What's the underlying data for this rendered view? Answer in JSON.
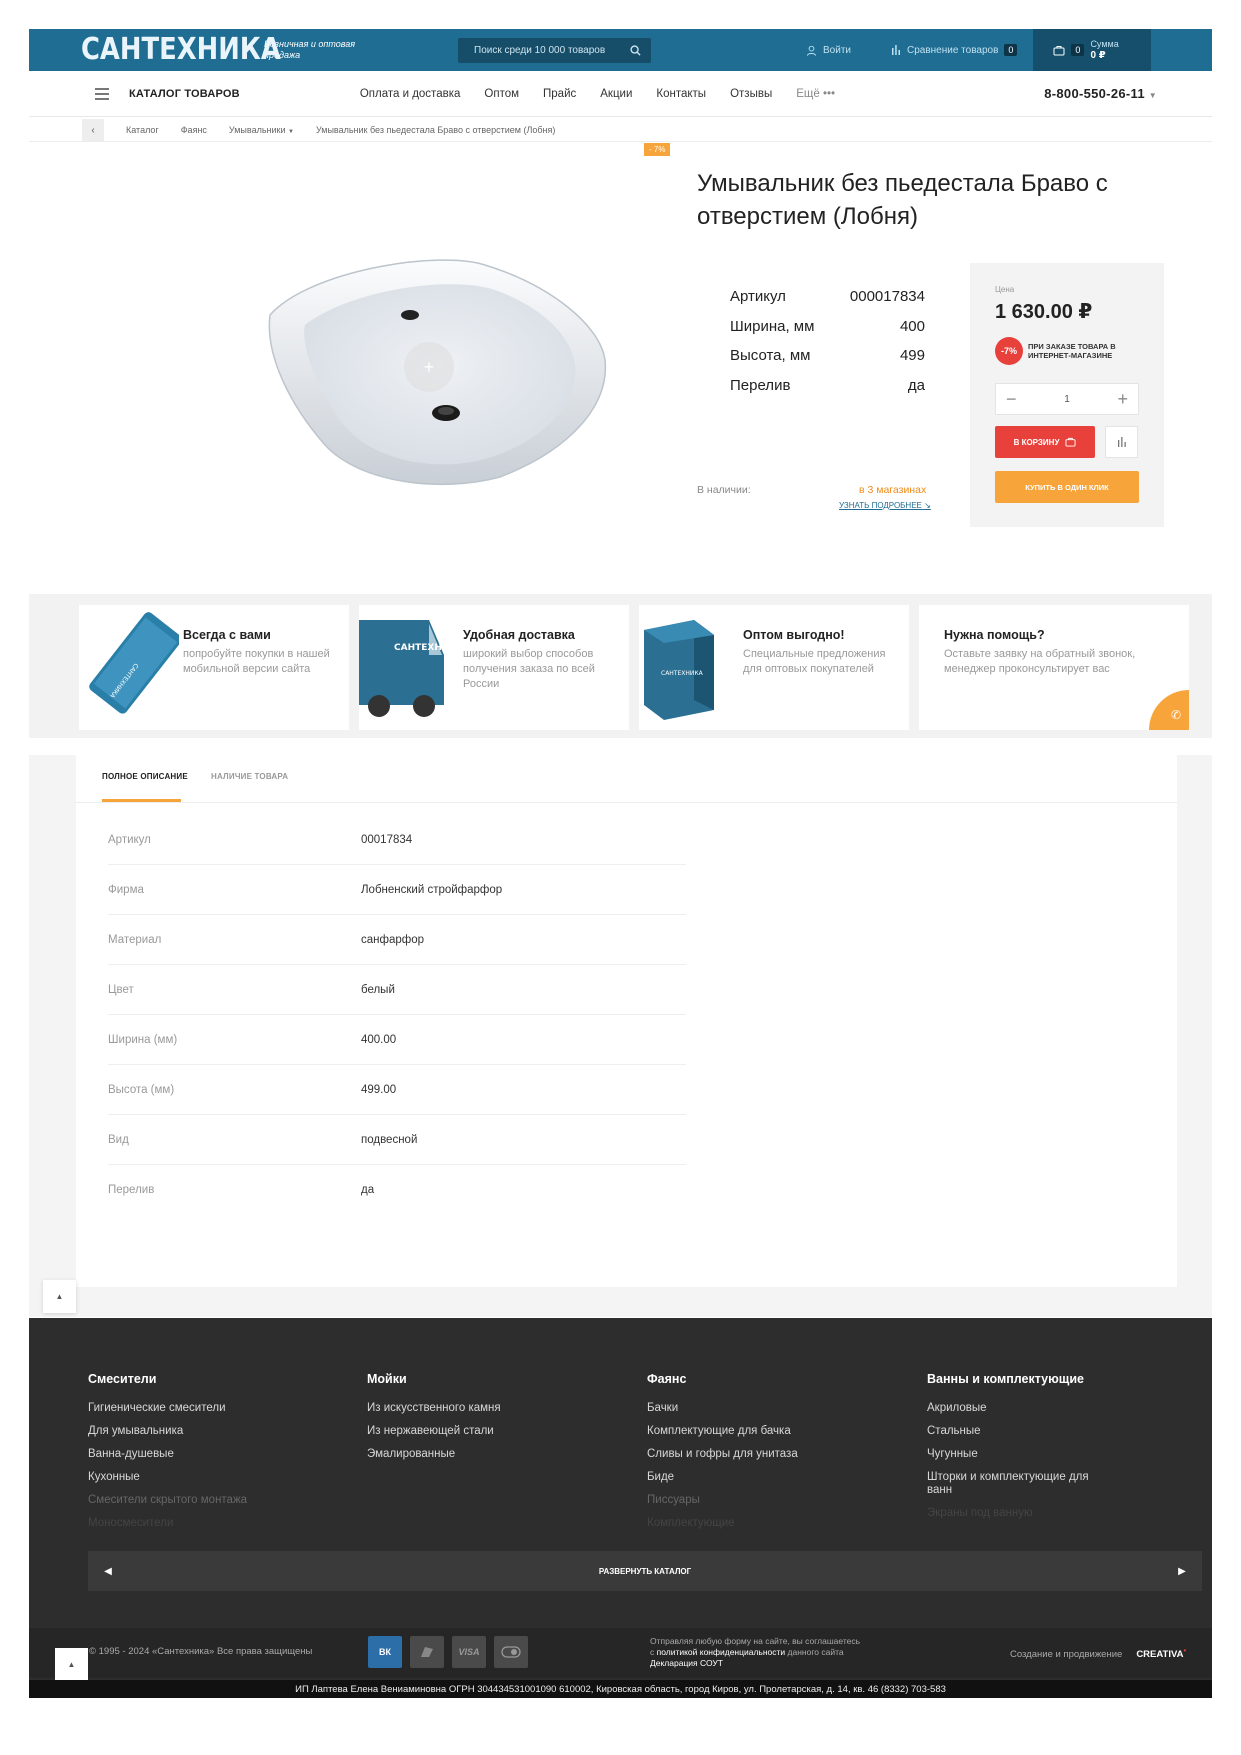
{
  "header": {
    "logo": "САНТЕХНИКА",
    "tagline": "Розничная и оптовая продажа",
    "search_placeholder": "Поиск среди 10 000 товаров",
    "login": "Войти",
    "compare": "Сравнение товаров",
    "compare_count": "0",
    "cart_count": "0",
    "sum_label": "Сумма",
    "sum_value": "0 ₽"
  },
  "nav": {
    "catalog": "КАТАЛОГ ТОВАРОВ",
    "items": [
      "Оплата и доставка",
      "Оптом",
      "Прайс",
      "Акции",
      "Контакты",
      "Отзывы"
    ],
    "more": "Ещё",
    "phone": "8-800-550-26-11"
  },
  "breadcrumb": [
    "Каталог",
    "Фаянс",
    "Умывальники",
    "Умывальник без пьедестала Браво с отверстием (Лобня)"
  ],
  "product": {
    "discount_tag": "- 7%",
    "title": "Умывальник без пьедестала Браво с отверстием (Лобня)",
    "props": [
      {
        "k": "Артикул",
        "v": "000017834"
      },
      {
        "k": "Ширина, мм",
        "v": "400"
      },
      {
        "k": "Высота, мм",
        "v": "499"
      },
      {
        "k": "Перелив",
        "v": "да"
      }
    ],
    "instock_label": "В наличии:",
    "instock_value": "в 3 магазинах",
    "more_link": "УЗНАТЬ ПОДРОБНЕЕ",
    "price_label": "Цена",
    "price": "1 630.00 ₽",
    "badge": "-7%",
    "badge_note": "ПРИ ЗАКАЗЕ ТОВАРА В ИНТЕРНЕТ-МАГАЗИНЕ",
    "qty": "1",
    "cart_btn": "В КОРЗИНУ",
    "one_click": "КУПИТЬ В ОДИН КЛИК"
  },
  "features": [
    {
      "title": "Всегда с вами",
      "text": "попробуйте покупки в нашей мобильной версии сайта"
    },
    {
      "title": "Удобная доставка",
      "text": "широкий выбор способов получения заказа по всей России"
    },
    {
      "title": "Оптом выгодно!",
      "text": "Специальные предложения для оптовых покупателей"
    },
    {
      "title": "Нужна помощь?",
      "text": "Оставьте заявку на обратный звонок, менеджер проконсультирует вас"
    }
  ],
  "tabs": [
    "ПОЛНОЕ ОПИСАНИЕ",
    "НАЛИЧИЕ ТОВАРА"
  ],
  "specs": [
    {
      "k": "Артикул",
      "v": "00017834"
    },
    {
      "k": "Фирма",
      "v": "Лобненский стройфарфор"
    },
    {
      "k": "Материал",
      "v": "санфарфор"
    },
    {
      "k": "Цвет",
      "v": "белый"
    },
    {
      "k": "Ширина (мм)",
      "v": "400.00"
    },
    {
      "k": "Высота (мм)",
      "v": "499.00"
    },
    {
      "k": "Вид",
      "v": "подвесной"
    },
    {
      "k": "Перелив",
      "v": "да"
    }
  ],
  "footer": {
    "cols": [
      {
        "h": "Смесители",
        "items": [
          "Гигиенические смесители",
          "Для умывальника",
          "Ванна-душевые",
          "Кухонные",
          "Смесители скрытого монтажа",
          "Моносмесители"
        ]
      },
      {
        "h": "Мойки",
        "items": [
          "Из искусственного камня",
          "Из нержавеющей стали",
          "Эмалированные"
        ]
      },
      {
        "h": "Фаянс",
        "items": [
          "Бачки",
          "Комплектующие для бачка",
          "Сливы и гофры для унитаза",
          "Биде",
          "Писсуары",
          "Комплектующие"
        ]
      },
      {
        "h": "Ванны и комплектующие",
        "items": [
          "Акриловые",
          "Стальные",
          "Чугунные",
          "Шторки и комплектующие для ванн",
          "Экраны под ванную"
        ]
      }
    ],
    "expand": "РАЗВЕРНУТЬ КАТАЛОГ",
    "copyright": "© 1995 - 2024 «Сантехника» Все права защищены",
    "pay": [
      "ВК",
      "",
      "VISA",
      ""
    ],
    "legal_1": "Отправляя любую форму на сайте, вы соглашаетесь",
    "legal_2a": "с ",
    "legal_2b": "политикой конфиденциальности",
    "legal_2c": " данного сайта",
    "legal_3": "Декларация СОУТ",
    "made": "Создание и продвижение",
    "studio": "CREATIVA",
    "address": "ИП Лаптева Елена Вениаминовна ОГРН 304434531001090 610002, Кировская область, город Киров, ул. Пролетарская, д. 14, кв. 46 (8332) 703-583"
  }
}
